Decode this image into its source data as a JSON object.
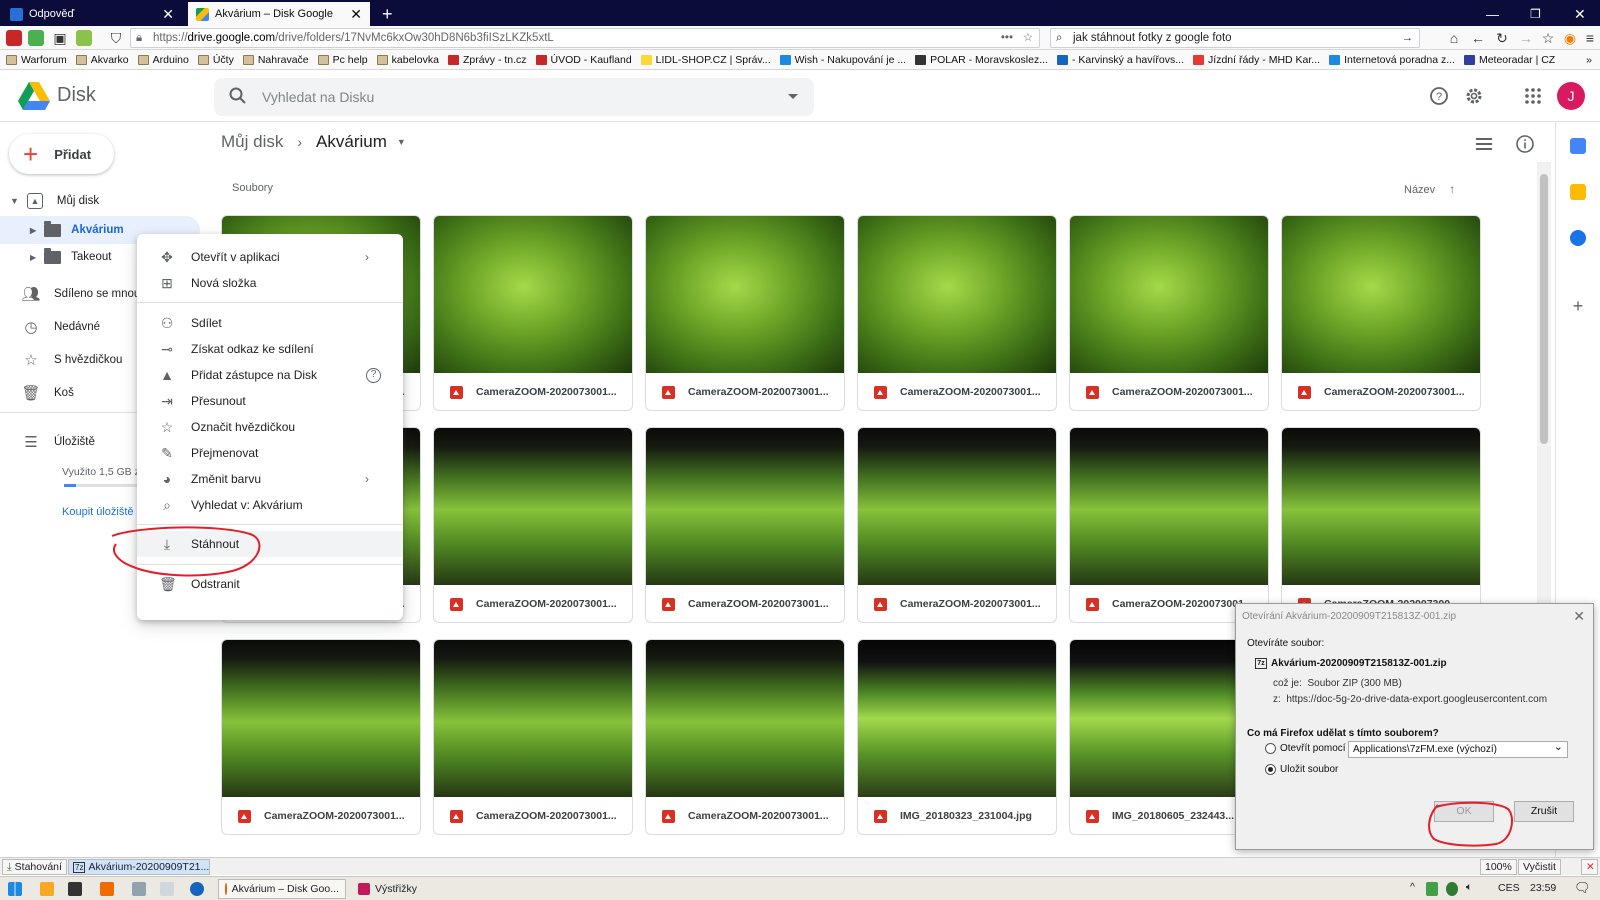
{
  "browser": {
    "tabs": [
      {
        "title": "Odpověď",
        "close": "✕"
      },
      {
        "title": "Akvárium – Disk Google",
        "close": "✕"
      }
    ],
    "new_tab": "+",
    "url_prefix": "https://",
    "url_domain": "drive.google.com",
    "url_path": "/drive/folders/17NvMc6kxOw30hD8N6b3fiISzLKZk5xtL",
    "search_value": "jak stáhnout fotky z google foto",
    "bookmarks": [
      "Warforum",
      "Akvarko",
      "Arduino",
      "Účty",
      "Nahravače",
      "Pc help",
      "kabelovka",
      "Zprávy - tn.cz",
      "ÚVOD - Kaufland",
      "LIDL-SHOP.CZ | Správ...",
      "Wish - Nakupování je ...",
      "POLAR - Moravskoslez...",
      "- Karvinský a havířovs...",
      "Jízdní řády - MHD Kar...",
      "Internetová poradna z...",
      "Meteoradar | CZ"
    ]
  },
  "drive": {
    "app_name": "Disk",
    "search_placeholder": "Vyhledat na Disku",
    "avatar_letter": "J",
    "new_button": "Přidat",
    "sidebar": {
      "my_drive": "Můj disk",
      "folders": [
        "Akvárium",
        "Takeout"
      ],
      "shared": "Sdíleno se mnou",
      "recent": "Nedávné",
      "starred": "S hvězdičkou",
      "trash": "Koš",
      "storage": "Úložiště",
      "storage_used": "Využito 1,5 GB z",
      "storage_used_fraction": 0.1,
      "buy_storage": "Koupit úložiště"
    },
    "breadcrumb": {
      "root": "Můj disk",
      "current": "Akvárium"
    },
    "files_label": "Soubory",
    "sort_label": "Název",
    "files": [
      {
        "name": "CameraZOOM-2020073001..."
      },
      {
        "name": "CameraZOOM-2020073001..."
      },
      {
        "name": "CameraZOOM-2020073001..."
      },
      {
        "name": "CameraZOOM-2020073001..."
      },
      {
        "name": "CameraZOOM-2020073001..."
      },
      {
        "name": "CameraZOOM-2020073001..."
      },
      {
        "name": "CameraZOOM-2020073001..."
      },
      {
        "name": "CameraZOOM-2020073001..."
      },
      {
        "name": "CameraZOOM-2020073001..."
      },
      {
        "name": "CameraZOOM-202007300..."
      },
      {
        "name": "CameraZOOM-2020073001..."
      },
      {
        "name": "CameraZOOM-2020073001..."
      },
      {
        "name": "CameraZOOM-2020073001..."
      },
      {
        "name": "IMG_20180323_231004.jpg"
      },
      {
        "name": "IMG_20180605_232443..."
      }
    ]
  },
  "context_menu": [
    {
      "label": "Otevřít v aplikaci",
      "icon": "move-icon",
      "submenu": "›"
    },
    {
      "label": "Nová složka",
      "icon": "new-folder-icon"
    },
    {
      "label": "Sdílet",
      "icon": "add-person-icon"
    },
    {
      "label": "Získat odkaz ke sdílení",
      "icon": "link-icon"
    },
    {
      "label": "Přidat zástupce na Disk",
      "icon": "shortcut-icon",
      "help": "?"
    },
    {
      "label": "Přesunout",
      "icon": "move-to-icon"
    },
    {
      "label": "Označit hvězdičkou",
      "icon": "star-icon"
    },
    {
      "label": "Přejmenovat",
      "icon": "pencil-icon"
    },
    {
      "label": "Změnit barvu",
      "icon": "palette-icon",
      "submenu": "›"
    },
    {
      "label": "Vyhledat v: Akvárium",
      "icon": "search-icon"
    },
    {
      "label": "Stáhnout",
      "icon": "download-icon"
    },
    {
      "label": "Odstranit",
      "icon": "trash-icon"
    }
  ],
  "dialog": {
    "title": "Otevírání Akvárium-20200909T215813Z-001.zip",
    "opening_label": "Otevíráte soubor:",
    "filename": "Akvárium-20200909T215813Z-001.zip",
    "type_label": "což je:",
    "type_value": "Soubor ZIP (300 MB)",
    "from_label": "z:",
    "from_value": "https://doc-5g-2o-drive-data-export.googleusercontent.com",
    "question": "Co má Firefox udělat s tímto souborem?",
    "open_with_label": "Otevřít pomocí",
    "open_with_value": "Applications\\7zFM.exe (výchozí)",
    "save_label": "Uložit soubor",
    "selected_option": "save",
    "ok": "OK",
    "cancel": "Zrušit"
  },
  "downloads_bar": {
    "items": [
      "Stahování",
      "Akvárium-20200909T21..."
    ],
    "zoom": "100%",
    "clear": "Vyčistit"
  },
  "taskbar": {
    "apps": [
      "Akvárium – Disk Goo...",
      "Výstřižky"
    ],
    "lang": "CES",
    "time": "23:59"
  },
  "colors": {
    "accent": "#1a73e8",
    "annotation": "#e0202a",
    "avatar": "#d81b60"
  }
}
